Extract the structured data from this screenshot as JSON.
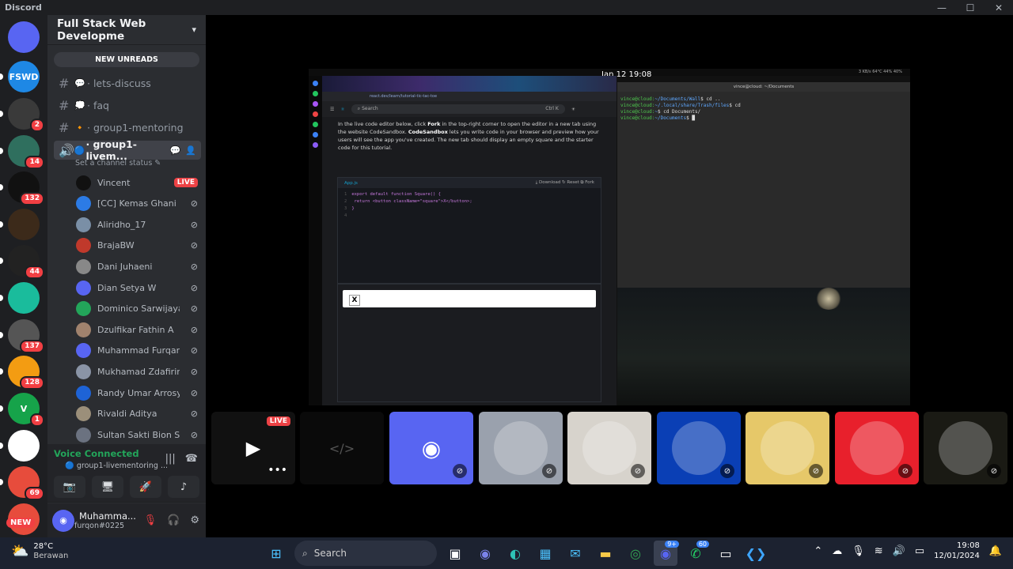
{
  "window": {
    "app_name": "Discord",
    "controls": [
      "—",
      "☐",
      "✕"
    ]
  },
  "servers": [
    {
      "label": "",
      "color": "#5865f2",
      "icon": "discord-home-icon"
    },
    {
      "label": "FSWD",
      "color": "#1e88e5",
      "badge": ""
    },
    {
      "label": "",
      "color": "#3a3a3a",
      "badge": "2"
    },
    {
      "label": "",
      "color": "#2f6f5e",
      "badge": "14"
    },
    {
      "label": "",
      "color": "#111111",
      "badge": "132"
    },
    {
      "label": "",
      "color": "#3c2a1a",
      "badge": ""
    },
    {
      "label": "",
      "color": "#222222",
      "badge": "44"
    },
    {
      "label": "",
      "color": "#1abc9c",
      "badge": ""
    },
    {
      "label": "",
      "color": "#555555",
      "badge": "137"
    },
    {
      "label": "",
      "color": "#f39c12",
      "badge": "128"
    },
    {
      "label": "V",
      "color": "#16a34a",
      "badge": "1"
    },
    {
      "label": "",
      "color": "#ffffff",
      "badge": ""
    },
    {
      "label": "",
      "color": "#e74c3c",
      "badge": "69"
    },
    {
      "label": "",
      "color": "#e74c3c",
      "badge": ""
    }
  ],
  "new_badge": "NEW",
  "sidebar": {
    "guild_name": "Full Stack Web Developme",
    "new_unreads": "NEW UNREADS",
    "channels": [
      {
        "emoji": "💬",
        "name": "· lets-discuss"
      },
      {
        "emoji": "💭",
        "name": "· faq"
      },
      {
        "emoji": "🔸",
        "name": "· group1-mentoring"
      }
    ],
    "voice_channel": {
      "emoji": "🔵",
      "name": "· group1-livem..."
    },
    "set_status": "Set a channel status",
    "members": [
      {
        "name": "Vincent",
        "live": "LIVE",
        "color": "#111111"
      },
      {
        "name": "[CC] Kemas Ghani ...",
        "color": "#2c7be5"
      },
      {
        "name": "Aliridho_17",
        "color": "#7a8fa6"
      },
      {
        "name": "BrajaBW",
        "color": "#c0392b"
      },
      {
        "name": "Dani Juhaeni",
        "color": "#888888"
      },
      {
        "name": "Dian Setya W",
        "color": "#5865f2"
      },
      {
        "name": "Dominico Sarwijaya...",
        "color": "#23a55a"
      },
      {
        "name": "Dzulfikar Fathin A",
        "color": "#a0826d"
      },
      {
        "name": "Muhammad Furqan",
        "color": "#5865f2"
      },
      {
        "name": "Mukhamad Zdafirin...",
        "color": "#8a94a6"
      },
      {
        "name": "Randy Umar Arrosy...",
        "color": "#1e63d6"
      },
      {
        "name": "Rivaldi Aditya",
        "color": "#9b8f7a"
      },
      {
        "name": "Sultan Sakti Bion S...",
        "color": "#6b7280"
      }
    ],
    "live_label": "LIVE"
  },
  "voice": {
    "status": "Voice Connected",
    "channel": "group1-livementoring ..."
  },
  "user": {
    "name": "Muhamma...",
    "tag": "furqon#0225"
  },
  "screen_share": {
    "topbar_clock": "Jan 12  19:08",
    "topbar_stats": "3 KB/s   64°C   44%   40%",
    "url_text": "react.dev/learn/tutorial-tic-tac-toe",
    "search_placeholder": "Search",
    "search_shortcut": "Ctrl K",
    "tutorial_lead": "In the live code editor below, click ",
    "fork_word": "Fork",
    "tutorial_mid": " in the top-right corner to open the editor in a new tab using the website CodeSandbox. ",
    "codesandbox_word": "CodeSandbox",
    "tutorial_tail": " lets you write code in your browser and preview how your users will see the app you've created. The new tab should display an empty square and the starter code for this tutorial.",
    "file_tab": "App.js",
    "editor_actions": "⤓ Download   ↻ Reset   ⧉ Fork",
    "code_lines": [
      "export default function Square() {",
      "  return <button className=\"square\">X</button>;",
      "}",
      ""
    ],
    "preview_value": "X",
    "terminal_title": "vince@cloud: ~/Documents",
    "terminal_lines": [
      {
        "prompt": "vince@cloud:",
        "path": "~/Documents/Wall",
        "cmd": "$ cd .."
      },
      {
        "prompt": "vince@cloud:",
        "path": "~/.local/share/Trash/files",
        "cmd": "$ cd"
      },
      {
        "prompt": "vince@cloud:",
        "path": "~",
        "cmd": "$ cd Documents/"
      },
      {
        "prompt": "vince@cloud:",
        "path": "~/Documents",
        "cmd": "$ █"
      }
    ]
  },
  "tiles": [
    {
      "kind": "stream",
      "live": "LIVE",
      "color": "#111111"
    },
    {
      "kind": "code",
      "color": "#0a0a0a"
    },
    {
      "kind": "discord",
      "color": "#5865f2"
    },
    {
      "kind": "avatar",
      "color": "#9aa1ad"
    },
    {
      "kind": "avatar",
      "color": "#d7d3cc"
    },
    {
      "kind": "avatar",
      "color": "#0a3fb5"
    },
    {
      "kind": "avatar",
      "color": "#e6c869"
    },
    {
      "kind": "avatar",
      "color": "#e8202c"
    },
    {
      "kind": "avatar",
      "color": "#1a1a14"
    }
  ],
  "taskbar": {
    "temperature": "28°C",
    "condition": "Berawan",
    "search": "Search",
    "discord_badge": "9+",
    "whatsapp_badge": "60",
    "time": "19:08",
    "date": "12/01/2024"
  }
}
